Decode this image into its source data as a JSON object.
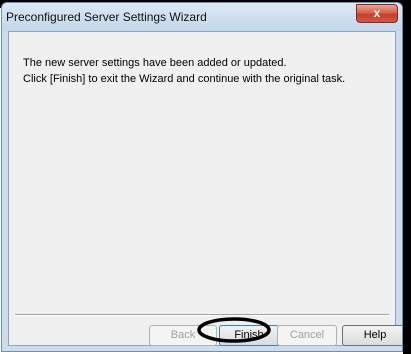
{
  "window": {
    "title": "Preconfigured Server Settings Wizard",
    "close_glyph": "x"
  },
  "message": {
    "line1": "The new server settings have been added or updated.",
    "line2": "Click [Finish] to exit the Wizard and continue with the original task."
  },
  "buttons": {
    "back": "Back",
    "finish": "Finish",
    "cancel": "Cancel",
    "help": "Help"
  },
  "highlight": {
    "color": "#000000",
    "target": "finish-button"
  }
}
